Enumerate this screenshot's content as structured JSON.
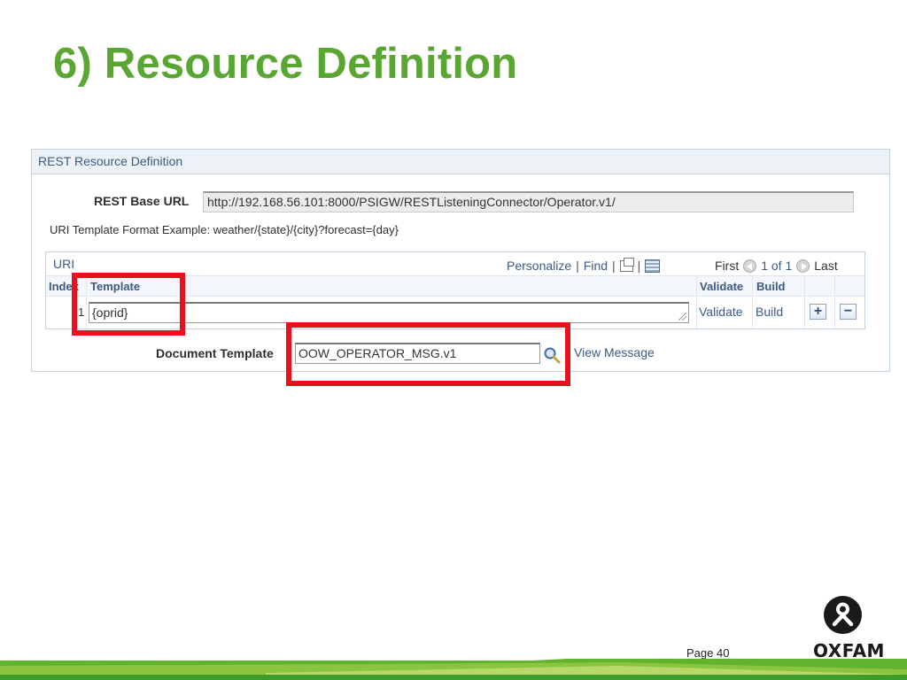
{
  "slide": {
    "title": "6) Resource Definition",
    "page_number": "Page 40",
    "logo_text": "OXFAM"
  },
  "panel": {
    "header": "REST Resource Definition",
    "base_url_label": "REST Base URL",
    "base_url_value": "http://192.168.56.101:8000/PSIGW/RESTListeningConnector/Operator.v1/",
    "uri_example": "URI Template Format Example: weather/{state}/{city}?forecast={day}"
  },
  "uri_grid": {
    "title": "URI",
    "toolbar": {
      "personalize": "Personalize",
      "separator": "|",
      "find": "Find",
      "zoom_icon": "new-window-icon",
      "download_icon": "spreadsheet-download-icon"
    },
    "nav": {
      "first": "First",
      "count": "1 of 1",
      "last": "Last"
    },
    "columns": {
      "index": "Index",
      "template": "Template",
      "validate": "Validate",
      "build": "Build"
    },
    "rows": [
      {
        "index": "1",
        "template": "{oprid}",
        "validate": "Validate",
        "build": "Build",
        "add_symbol": "+",
        "remove_symbol": "−"
      }
    ]
  },
  "document_template": {
    "label": "Document Template",
    "value": "OOW_OPERATOR_MSG.v1",
    "view_message": "View Message",
    "lookup_icon": "lookup-magnifier-icon"
  },
  "colors": {
    "title_green": "#5aa632",
    "highlight_red": "#e8121e",
    "link_blue": "#3b5a86",
    "footer_green": "#61b22d"
  }
}
